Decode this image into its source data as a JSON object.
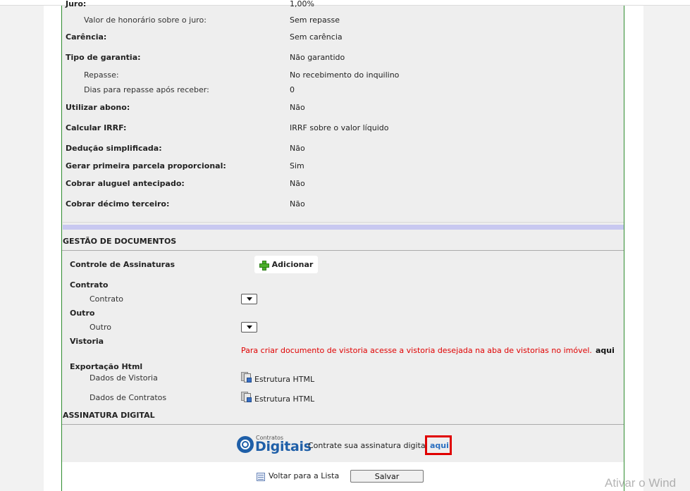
{
  "details": {
    "cut_top_label": "Juro:",
    "cut_top_value": "1,00%",
    "rows": [
      {
        "label": "Valor de honorário sobre o juro:",
        "value": "Sem repasse"
      },
      {
        "label": "Carência:",
        "value": "Sem carência"
      },
      {
        "label": "Tipo de garantia:",
        "value": "Não garantido"
      },
      {
        "label": "Repasse:",
        "value": "No recebimento do inquilino"
      },
      {
        "label": "Dias para repasse após receber:",
        "value": "0"
      },
      {
        "label": "Utilizar abono:",
        "value": "Não"
      },
      {
        "label": "Calcular IRRF:",
        "value": "IRRF sobre o valor líquido"
      },
      {
        "label": "Dedução simplificada:",
        "value": "Não"
      },
      {
        "label": "Gerar primeira parcela proporcional:",
        "value": "Sim"
      },
      {
        "label": "Cobrar aluguel antecipado:",
        "value": "Não"
      },
      {
        "label": "Cobrar décimo terceiro:",
        "value": "Não"
      }
    ]
  },
  "gestao": {
    "title": "GESTÃO DE DOCUMENTOS",
    "controle_label": "Controle de Assinaturas",
    "add_label": "Adicionar",
    "contrato_group": "Contrato",
    "contrato_item": "Contrato",
    "outro_group": "Outro",
    "outro_item": "Outro",
    "vistoria_group": "Vistoria",
    "vistoria_msg": "Para criar documento de vistoria acesse a vistoria desejada na aba de vistorias no imóvel.",
    "vistoria_link": "aqui",
    "export_group": "Exportação Html",
    "export_rows": [
      {
        "label": "Dados de Vistoria",
        "link": "Estrutura HTML"
      },
      {
        "label": "Dados de Contratos",
        "link": "Estrutura HTML"
      }
    ]
  },
  "assinatura": {
    "title": "ASSINATURA DIGITAL",
    "logo_small": "Contratos",
    "logo_big": "Digitais",
    "text": "Contrate sua assinatura digita",
    "link": "aqui"
  },
  "footer": {
    "back_label": "Voltar para a Lista",
    "save_label": "Salvar"
  },
  "watermark": "Ativar o Wind"
}
